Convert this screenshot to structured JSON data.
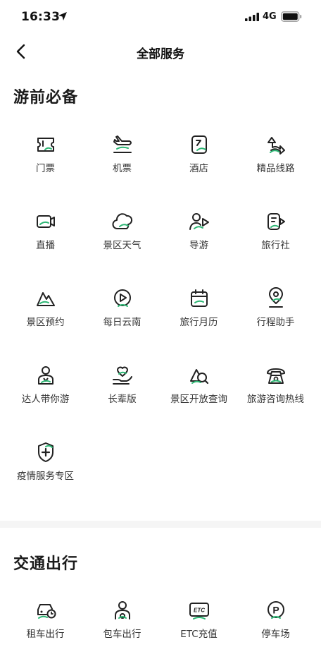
{
  "status": {
    "time": "16:33",
    "network": "4G"
  },
  "nav": {
    "title": "全部服务"
  },
  "sections": [
    {
      "title": "游前必备",
      "items": [
        {
          "label": "门票",
          "icon": "ticket-icon"
        },
        {
          "label": "机票",
          "icon": "airplane-icon"
        },
        {
          "label": "酒店",
          "icon": "hotel-icon"
        },
        {
          "label": "精品线路",
          "icon": "route-icon"
        },
        {
          "label": "直播",
          "icon": "live-camera-icon"
        },
        {
          "label": "景区天气",
          "icon": "weather-icon"
        },
        {
          "label": "导游",
          "icon": "guide-icon"
        },
        {
          "label": "旅行社",
          "icon": "agency-icon"
        },
        {
          "label": "景区预约",
          "icon": "mountain-icon"
        },
        {
          "label": "每日云南",
          "icon": "play-icon"
        },
        {
          "label": "旅行月历",
          "icon": "calendar-icon"
        },
        {
          "label": "行程助手",
          "icon": "location-pin-icon"
        },
        {
          "label": "达人带你游",
          "icon": "expert-icon"
        },
        {
          "label": "长辈版",
          "icon": "heart-hand-icon"
        },
        {
          "label": "景区开放查询",
          "icon": "search-mountain-icon"
        },
        {
          "label": "旅游咨询热线",
          "icon": "phone-icon"
        },
        {
          "label": "疫情服务专区",
          "icon": "shield-plus-icon"
        }
      ]
    },
    {
      "title": "交通出行",
      "items": [
        {
          "label": "租车出行",
          "icon": "car-rental-icon"
        },
        {
          "label": "包车出行",
          "icon": "driver-icon"
        },
        {
          "label": "ETC充值",
          "icon": "etc-icon",
          "icon_text": "ETC"
        },
        {
          "label": "停车场",
          "icon": "parking-icon",
          "icon_text": "P"
        }
      ]
    }
  ],
  "colors": {
    "accent": "#2bb673",
    "icon_stroke": "#222222"
  }
}
